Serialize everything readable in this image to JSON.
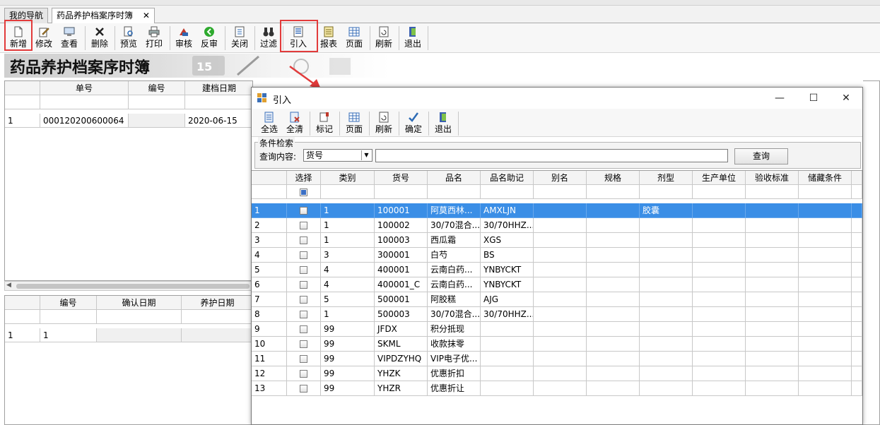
{
  "tabs": [
    {
      "label": "我的导航"
    },
    {
      "label": "药品养护档案序时簿",
      "close": "✕"
    }
  ],
  "toolbar": [
    {
      "label": "新增",
      "icon": "new-doc-icon"
    },
    {
      "label": "修改",
      "icon": "edit-icon"
    },
    {
      "label": "查看",
      "icon": "view-icon"
    },
    {
      "label": "删除",
      "icon": "delete-icon"
    },
    {
      "label": "预览",
      "icon": "preview-icon"
    },
    {
      "label": "打印",
      "icon": "print-icon"
    },
    {
      "label": "审核",
      "icon": "audit-icon"
    },
    {
      "label": "反审",
      "icon": "unaudit-icon"
    },
    {
      "label": "关闭",
      "icon": "close-doc-icon"
    },
    {
      "label": "过滤",
      "icon": "binoculars-icon"
    },
    {
      "label": "引入",
      "icon": "import-icon"
    },
    {
      "label": "报表",
      "icon": "report-icon"
    },
    {
      "label": "页面",
      "icon": "page-icon"
    },
    {
      "label": "刷新",
      "icon": "refresh-icon"
    },
    {
      "label": "退出",
      "icon": "exit-icon"
    }
  ],
  "banner": {
    "title": "药品养护档案序时簿",
    "number": "15"
  },
  "upper_grid": {
    "headers": [
      "单号",
      "编号",
      "建档日期"
    ],
    "rows": [
      [
        "1",
        "000120200600064",
        "",
        "2020-06-15"
      ]
    ]
  },
  "lower_grid": {
    "headers": [
      "编号",
      "确认日期",
      "养护日期"
    ],
    "rows": [
      [
        "1",
        "1",
        "",
        ""
      ]
    ]
  },
  "dialog": {
    "title": "引入",
    "controls": {
      "minimize": "—",
      "maximize": "☐",
      "close": "✕"
    },
    "toolbar": [
      {
        "label": "全选",
        "icon": "select-all-icon"
      },
      {
        "label": "全清",
        "icon": "clear-all-icon"
      },
      {
        "label": "标记",
        "icon": "mark-icon"
      },
      {
        "label": "页面",
        "icon": "page-icon"
      },
      {
        "label": "刷新",
        "icon": "refresh-icon"
      },
      {
        "label": "确定",
        "icon": "checkmark-icon"
      },
      {
        "label": "退出",
        "icon": "exit-icon"
      }
    ],
    "search": {
      "legend": "条件检索",
      "label": "查询内容:",
      "field": "货号",
      "value": "",
      "button": "查询"
    },
    "grid": {
      "headers": [
        "选择",
        "类别",
        "货号",
        "品名",
        "品名助记",
        "别名",
        "规格",
        "剂型",
        "生产单位",
        "验收标准",
        "储藏条件"
      ],
      "rows": [
        {
          "n": "1",
          "cat": "1",
          "code": "100001",
          "name": "阿莫西林...",
          "memo": "AMXLJN",
          "form": "胶囊"
        },
        {
          "n": "2",
          "cat": "1",
          "code": "100002",
          "name": "30/70混合...",
          "memo": "30/70HHZ...",
          "form": ""
        },
        {
          "n": "3",
          "cat": "1",
          "code": "100003",
          "name": "西瓜霜",
          "memo": "XGS",
          "form": ""
        },
        {
          "n": "4",
          "cat": "3",
          "code": "300001",
          "name": "白芍",
          "memo": "BS",
          "form": ""
        },
        {
          "n": "5",
          "cat": "4",
          "code": "400001",
          "name": "云南白药...",
          "memo": "YNBYCKT",
          "form": ""
        },
        {
          "n": "6",
          "cat": "4",
          "code": "400001_C",
          "name": "云南白药...",
          "memo": "YNBYCKT",
          "form": ""
        },
        {
          "n": "7",
          "cat": "5",
          "code": "500001",
          "name": "阿胶糕",
          "memo": "AJG",
          "form": ""
        },
        {
          "n": "8",
          "cat": "1",
          "code": "500003",
          "name": "30/70混合...",
          "memo": "30/70HHZ...",
          "form": ""
        },
        {
          "n": "9",
          "cat": "99",
          "code": "JFDX",
          "name": "积分抵现",
          "memo": "",
          "form": ""
        },
        {
          "n": "10",
          "cat": "99",
          "code": "SKML",
          "name": "收款抹零",
          "memo": "",
          "form": ""
        },
        {
          "n": "11",
          "cat": "99",
          "code": "VIPDZYHQ",
          "name": "VIP电子优...",
          "memo": "",
          "form": ""
        },
        {
          "n": "12",
          "cat": "99",
          "code": "YHZK",
          "name": "优惠折扣",
          "memo": "",
          "form": ""
        },
        {
          "n": "13",
          "cat": "99",
          "code": "YHZR",
          "name": "优惠折让",
          "memo": "",
          "form": ""
        }
      ]
    }
  },
  "colors": {
    "highlight_box": "#e23b3b",
    "selected_row": "#3a8ee6",
    "arrow": "#e23b3b"
  }
}
